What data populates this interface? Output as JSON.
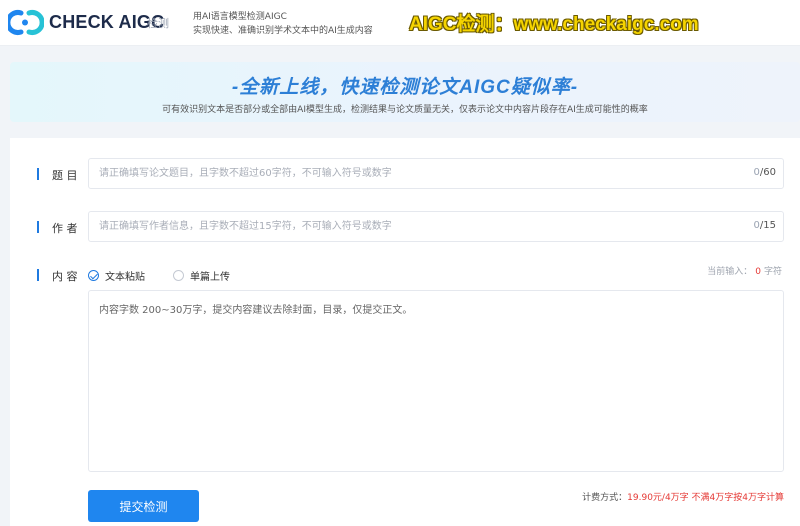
{
  "header": {
    "brand": "CHECK AIGC",
    "brand_sub": "检测",
    "tagline1": "用AI语言模型检测AIGC",
    "tagline2": "实现快速、准确识别学术文本中的AI生成内容",
    "promo": "AIGC检测：www.checkaigc.com",
    "logo_icon": "checkaigc-logo-icon"
  },
  "banner": {
    "title": "-全新上线，快速检测论文AIGC疑似率-",
    "subtitle": "可有效识别文本是否部分或全部由AI模型生成，检测结果与论文质量无关，仅表示论文中内容片段存在AI生成可能性的概率"
  },
  "form": {
    "title_label": "题 目",
    "title_placeholder": "请正确填写论文题目，且字数不超过60字符，不可输入符号或数字",
    "title_count_current": "0",
    "title_count_max": "/60",
    "author_label": "作 者",
    "author_placeholder": "请正确填写作者信息，且字数不超过15字符，不可输入符号或数字",
    "author_count_current": "0",
    "author_count_max": "/15",
    "content_label": "内 容",
    "option_paste": "文本粘贴",
    "option_upload": "单篇上传",
    "current_input_prefix": "当前输入：",
    "current_input_count": "0",
    "current_input_suffix": "字符",
    "content_placeholder": "内容字数 200~30万字，提交内容建议去除封面，目录，仅提交正文。",
    "submit_label": "提交检测",
    "price_prefix": "计费方式：",
    "price_value": "19.90元/4万字 不满4万字按4万字计算"
  },
  "colors": {
    "accent": "#1f86ef",
    "promo": "#f5d400",
    "warning": "#e53935"
  }
}
